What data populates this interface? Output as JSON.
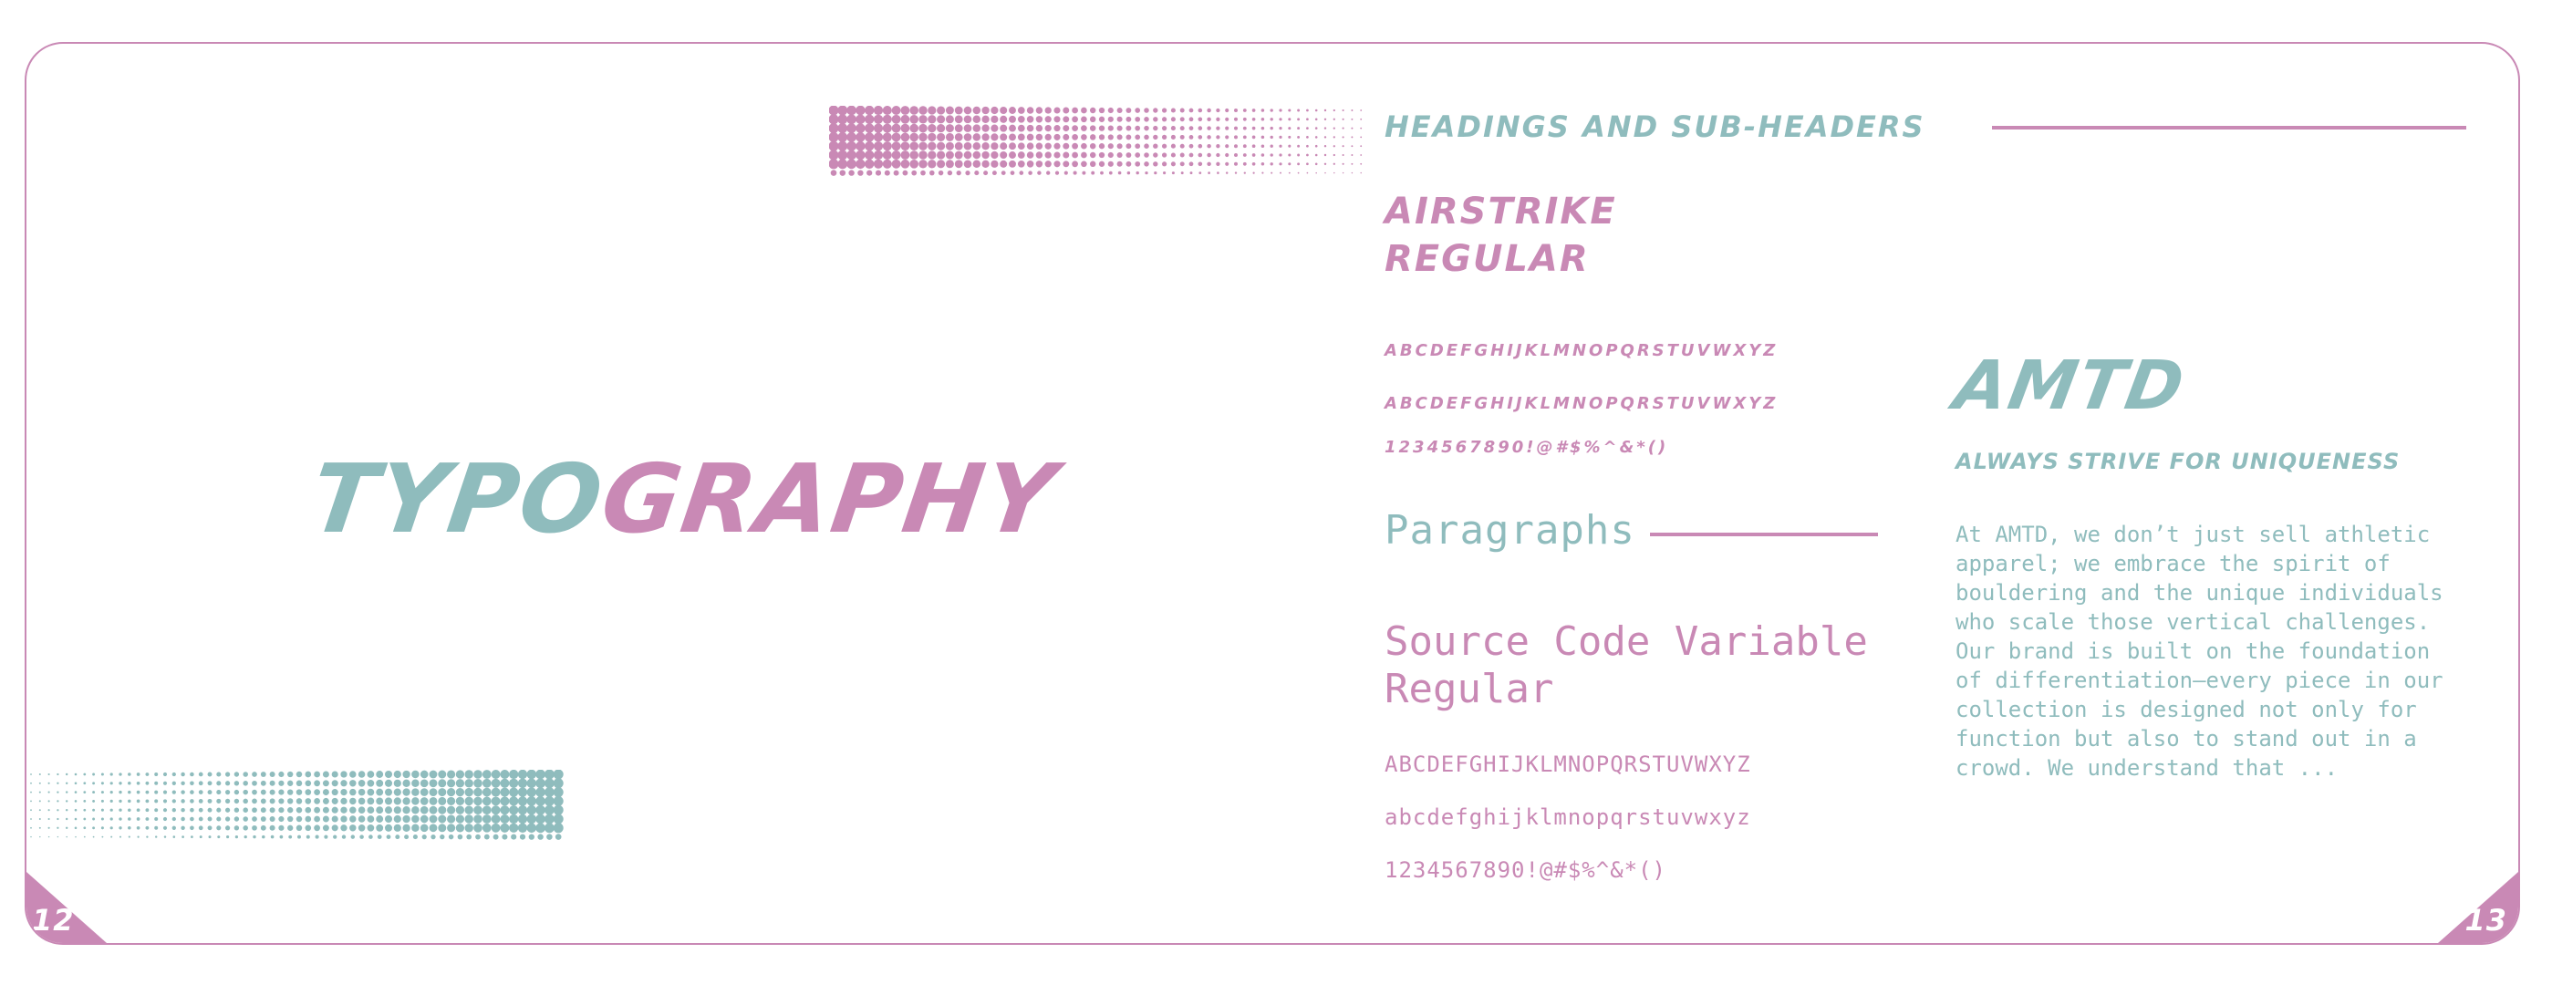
{
  "colors": {
    "teal": "#8fbcbd",
    "pink": "#c989b5",
    "border": "#c989b5"
  },
  "page_numbers": {
    "left": "12",
    "right": "13"
  },
  "title": {
    "part1": "TYPO",
    "part2": "GRAPHY"
  },
  "headings": {
    "section_label": "HEADINGS AND SUB-HEADERS",
    "font_name_line1": "AIRSTRIKE",
    "font_name_line2": "REGULAR",
    "samples": [
      "ABCDEFGHIJKLMNOPQRSTUVWXYZ",
      "ABCDEFGHIJKLMNOPQRSTUVWXYZ",
      "1234567890!@#$%^&*()"
    ]
  },
  "paragraphs": {
    "section_label": "Paragraphs",
    "font_name": "Source Code Variable Regular",
    "samples": [
      "ABCDEFGHIJKLMNOPQRSTUVWXYZ",
      "abcdefghijklmnopqrstuvwxyz",
      "1234567890!@#$%^&*()"
    ]
  },
  "example": {
    "brand": "AMTD",
    "tagline": "ALWAYS STRIVE FOR UNIQUENESS",
    "body": "At AMTD, we don’t just sell athletic apparel; we embrace the spirit of bouldering and the unique individuals who scale those vertical challenges. Our brand is built on the foundation of differentiation—every piece in our collection is designed not only for function but also to stand out in a crowd. We understand that ..."
  }
}
